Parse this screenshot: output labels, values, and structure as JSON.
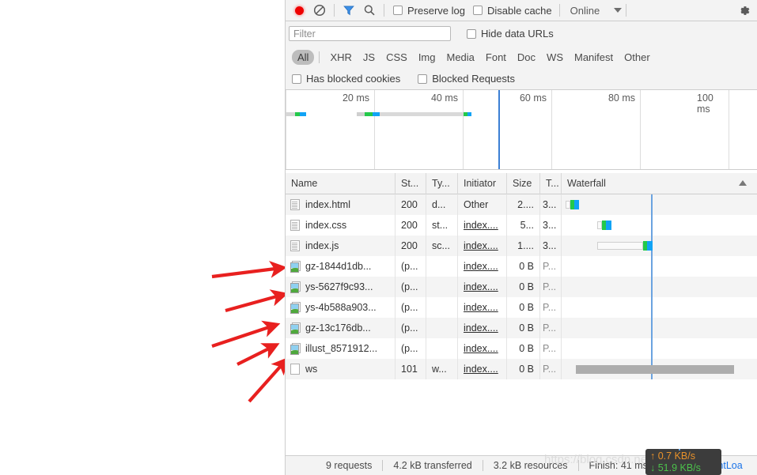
{
  "toolbar": {
    "record_icon": "record-circle-icon",
    "clear_icon": "clear-prohibit-icon",
    "filter_icon": "funnel-filter-icon",
    "search_icon": "search-magnifier-icon",
    "preserve_log_label": "Preserve log",
    "disable_cache_label": "Disable cache",
    "throttle_value": "Online",
    "throttle_caret_icon": "chevron-down-icon",
    "settings_icon": "gear-icon"
  },
  "filter": {
    "placeholder": "Filter",
    "value": "",
    "hide_data_urls_label": "Hide data URLs"
  },
  "types": {
    "items": [
      "All",
      "XHR",
      "JS",
      "CSS",
      "Img",
      "Media",
      "Font",
      "Doc",
      "WS",
      "Manifest",
      "Other"
    ],
    "active": "All"
  },
  "blocked": {
    "has_blocked_cookies_label": "Has blocked cookies",
    "blocked_requests_label": "Blocked Requests"
  },
  "overview": {
    "ticks": [
      "20 ms",
      "40 ms",
      "60 ms",
      "80 ms",
      "100 ms"
    ]
  },
  "table": {
    "columns": [
      "Name",
      "St...",
      "Ty...",
      "Initiator",
      "Size",
      "T...",
      "Waterfall"
    ],
    "sort_icon": "sort-ascending-triangle-icon",
    "rows": [
      {
        "icon": "document-file-icon",
        "name": "index.html",
        "status": "200",
        "type": "d...",
        "initiator": "Other",
        "initiator_link": false,
        "size": "2....",
        "time": "3...",
        "time_dim": false
      },
      {
        "icon": "document-file-icon",
        "name": "index.css",
        "status": "200",
        "type": "st...",
        "initiator": "index....",
        "initiator_link": true,
        "size": "5...",
        "time": "3...",
        "time_dim": false
      },
      {
        "icon": "document-file-icon",
        "name": "index.js",
        "status": "200",
        "type": "sc...",
        "initiator": "index....",
        "initiator_link": true,
        "size": "1....",
        "time": "3...",
        "time_dim": false
      },
      {
        "icon": "image-file-icon",
        "name": "gz-1844d1db...",
        "status": "(p...",
        "type": "",
        "initiator": "index....",
        "initiator_link": true,
        "size": "0 B",
        "time": "P...",
        "time_dim": true
      },
      {
        "icon": "image-file-icon",
        "name": "ys-5627f9c93...",
        "status": "(p...",
        "type": "",
        "initiator": "index....",
        "initiator_link": true,
        "size": "0 B",
        "time": "P...",
        "time_dim": true
      },
      {
        "icon": "image-file-icon",
        "name": "ys-4b588a903...",
        "status": "(p...",
        "type": "",
        "initiator": "index....",
        "initiator_link": true,
        "size": "0 B",
        "time": "P...",
        "time_dim": true
      },
      {
        "icon": "image-file-icon",
        "name": "gz-13c176db...",
        "status": "(p...",
        "type": "",
        "initiator": "index....",
        "initiator_link": true,
        "size": "0 B",
        "time": "P...",
        "time_dim": true
      },
      {
        "icon": "image-file-icon",
        "name": "illust_8571912...",
        "status": "(p...",
        "type": "",
        "initiator": "index....",
        "initiator_link": true,
        "size": "0 B",
        "time": "P...",
        "time_dim": true
      },
      {
        "icon": "plain-file-icon",
        "name": "ws",
        "status": "101",
        "type": "w...",
        "initiator": "index....",
        "initiator_link": true,
        "size": "0 B",
        "time": "P...",
        "time_dim": true
      }
    ]
  },
  "statusbar": {
    "requests": "9 requests",
    "transferred": "4.2 kB transferred",
    "resources": "3.2 kB resources",
    "finish": "Finish: 41 ms",
    "dom_content_loaded": "DOMContentLoa"
  },
  "nettip": {
    "upload": "↑ 0.7 KB/s",
    "download": "↓ 51.9 KB/s"
  },
  "watermark": {
    "text": "https://blog.csdn.net/yanhanhuif"
  },
  "colors": {
    "accent_blue": "#1a73e8",
    "record_red": "#ee0000",
    "annotation_red": "#e8201f",
    "waterfall_green": "#24c94a",
    "waterfall_blue": "#11a3f5",
    "upload_orange": "#e8912a",
    "download_green": "#4bc14b"
  }
}
